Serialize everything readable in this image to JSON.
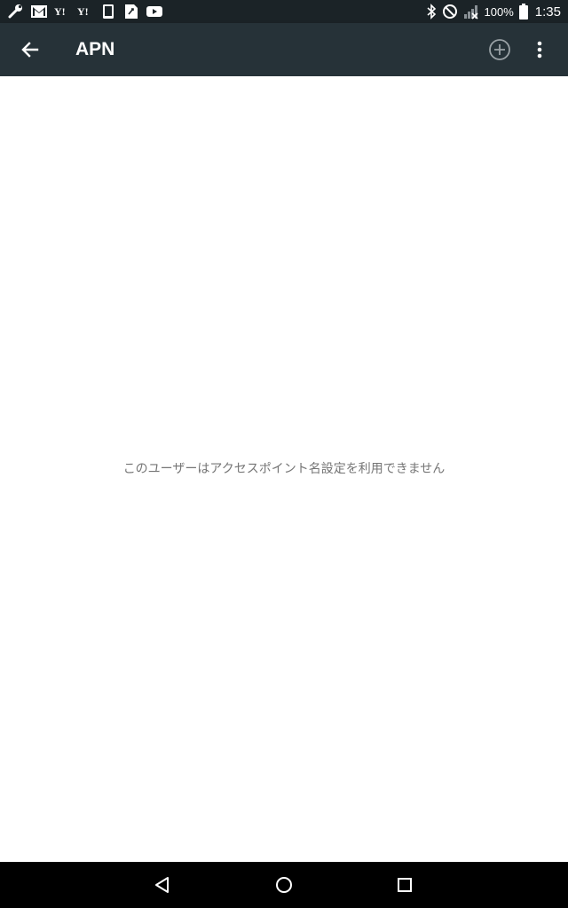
{
  "status_bar": {
    "left_icons": [
      "wrench-icon",
      "gmail-icon",
      "yahoo-icon",
      "yahoo-icon",
      "tablet-icon",
      "sim-icon",
      "youtube-icon"
    ],
    "yahoo_label": "Y!",
    "right_icons": [
      "bluetooth-icon",
      "do-not-disturb-icon",
      "signal-icon",
      "battery-icon"
    ],
    "battery_percent": "100%",
    "time": "1:35"
  },
  "app_bar": {
    "title": "APN",
    "background_color": "#263238",
    "actions": [
      "back-arrow-icon",
      "add-circle-icon",
      "more-vert-icon"
    ]
  },
  "content": {
    "message": "このユーザーはアクセスポイント名設定を利用できません"
  },
  "nav_bar": {
    "buttons": [
      "back-triangle-icon",
      "home-circle-icon",
      "recents-square-icon"
    ]
  }
}
